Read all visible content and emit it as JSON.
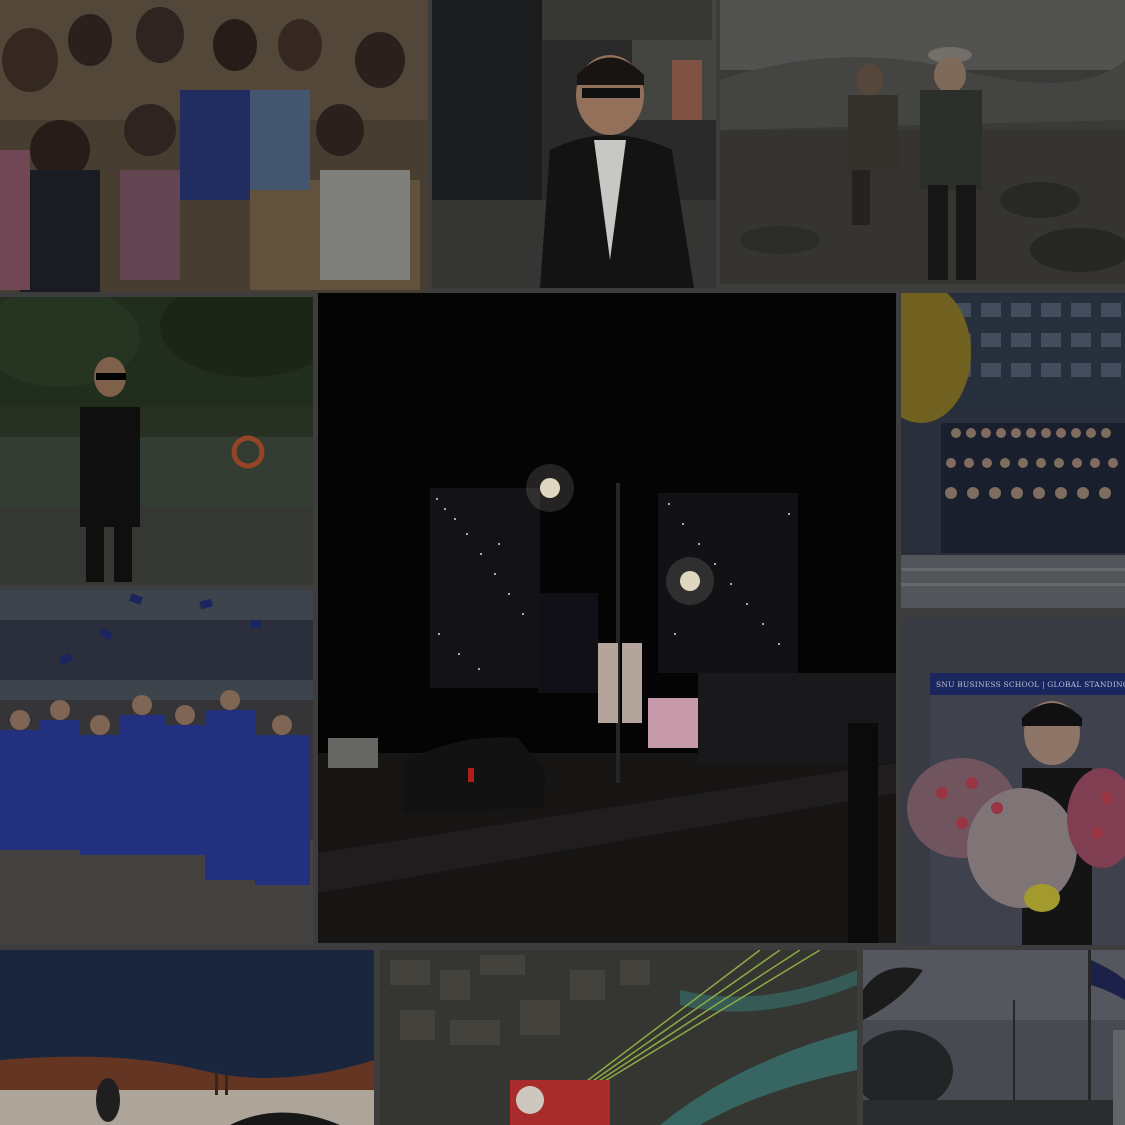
{
  "collage": {
    "tiles": [
      {
        "id": "group-friends",
        "subject": "group of friends posing with v-signs"
      },
      {
        "id": "man-in-suit-glasses",
        "subject": "man in dark suit and glasses smiling"
      },
      {
        "id": "hiker-mountain",
        "subject": "hikers on a rocky mountain trail"
      },
      {
        "id": "man-sunglasses-park",
        "subject": "man in suit with sunglasses in a park"
      },
      {
        "id": "night-city-street",
        "subject": "city street at night with skyscrapers and street lamps"
      },
      {
        "id": "group-in-suits-building",
        "subject": "large group in suits in front of a building"
      },
      {
        "id": "graduation-cap-toss",
        "subject": "graduates in blue gowns tossing caps"
      },
      {
        "id": "graduate-with-flowers",
        "subject": "graduate holding bouquets of flowers",
        "banner_text": "SNU BUSINESS SCHOOL | GLOBAL STANDING"
      },
      {
        "id": "desert-dunes",
        "subject": "person in a desert with red dunes"
      },
      {
        "id": "paragliding-city",
        "subject": "paraglider above a city and river"
      },
      {
        "id": "flag-trees",
        "subject": "flagpole among trees"
      }
    ]
  }
}
